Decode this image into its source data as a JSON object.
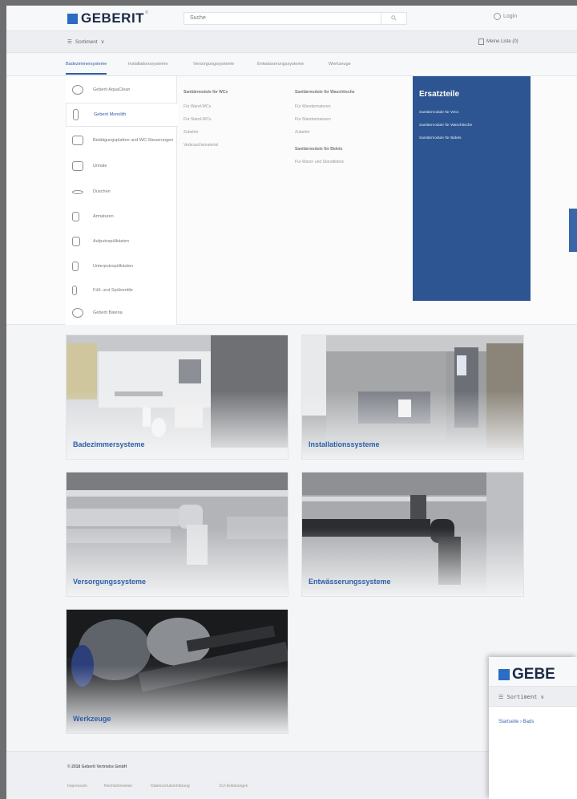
{
  "brand": {
    "name": "GEBERIT",
    "reg": "®"
  },
  "header": {
    "search_placeholder": "Suche",
    "login_label": "Login",
    "sortiment_label": "Sortiment",
    "merkliste_label": "Meine Liste (0)"
  },
  "tabs": [
    {
      "label": "Badezimmersysteme"
    },
    {
      "label": "Installationssysteme"
    },
    {
      "label": "Versorgungssysteme"
    },
    {
      "label": "Entwässerungssysteme"
    },
    {
      "label": "Werkzeuge"
    }
  ],
  "categories": [
    {
      "label": "Geberit AquaClean"
    },
    {
      "label": "Geberit Monolith"
    },
    {
      "label": "Betätigungsplatten und WC-Steuerungen"
    },
    {
      "label": "Urinale"
    },
    {
      "label": "Duschen"
    },
    {
      "label": "Armaturen"
    },
    {
      "label": "Aufputzspülkästen"
    },
    {
      "label": "Unterputzspülkästen"
    },
    {
      "label": "Füll- und Spülventile"
    },
    {
      "label": "Geberit Balena"
    }
  ],
  "menu_columns": {
    "col1": {
      "head": "Sanitärmodule für WCs",
      "links": [
        "Für Wand-WCs",
        "Für Stand-WCs",
        "Zubehör",
        "Verbrauchsmaterial"
      ]
    },
    "col2": {
      "head": "Sanitärmodule für Waschtische",
      "links": [
        "Für Wandarmaturen",
        "Für Standarmaturen",
        "Zubehör"
      ],
      "head2": "Sanitärmodule für Bidets",
      "links2": [
        "Für Wand- und Standbidets"
      ]
    }
  },
  "ersatzteile": {
    "title": "Ersatzteile",
    "links": [
      "Sanitärmodule für WCs",
      "Sanitärmodule für Waschtische",
      "Sanitärmodule für Bidets"
    ]
  },
  "tiles": [
    {
      "label": "Badezimmersysteme"
    },
    {
      "label": "Installationssysteme"
    },
    {
      "label": "Versorgungssysteme"
    },
    {
      "label": "Entwässerungssysteme"
    },
    {
      "label": "Werkzeuge"
    }
  ],
  "footer": {
    "copyright": "© 2018 Geberit Vertriebs GmbH",
    "links": [
      "Impressum",
      "Rechtshinweise",
      "Datenschutzerklärung",
      "EU-Erklärungen"
    ]
  },
  "overlay": {
    "logo_partial": "GEBE",
    "sortiment": "Sortiment ∨",
    "breadcrumb": "Startseite  ›  Bads"
  },
  "colors": {
    "brand_blue": "#2b5fa8",
    "ersatz_bg": "#2d5591"
  }
}
